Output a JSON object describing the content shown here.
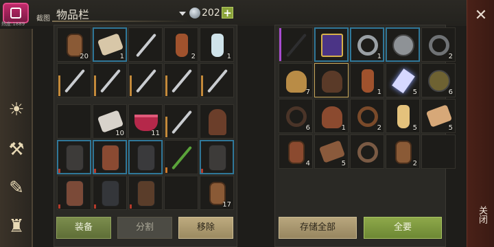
{
  "header": {
    "logo_text": "热度:1889",
    "screenshot_label": "截图",
    "title": "物品栏",
    "currency_value": "202",
    "add_label": "+"
  },
  "sidebar": {
    "icons": [
      "sun-scroll-icon",
      "hammer-icon",
      "scroll-quill-icon",
      "character-icon"
    ]
  },
  "inventory_top": {
    "counts": [
      "20",
      "1",
      "",
      "2",
      "1",
      "",
      "",
      "",
      "",
      ""
    ]
  },
  "inventory_bottom": {
    "counts": [
      "",
      "10",
      "11",
      "",
      "",
      "",
      "",
      "",
      "",
      "",
      "",
      "",
      "",
      "",
      "17"
    ]
  },
  "storage": {
    "counts": [
      "",
      "",
      "1",
      "",
      "2",
      "7",
      "",
      "1",
      "5",
      "6",
      "6",
      "1",
      "2",
      "5",
      "5",
      "4",
      "5",
      "",
      "2",
      ""
    ]
  },
  "buttons": {
    "equip": "装备",
    "split": "分割",
    "remove": "移除",
    "store_all": "存储全部",
    "take_all": "全要"
  },
  "close": {
    "x": "✕",
    "label": "关闭"
  },
  "colors": {
    "accent_green": "#8aa33a",
    "rarity_blue": "#2f7fa3",
    "rarity_purple": "#a84cd0"
  }
}
